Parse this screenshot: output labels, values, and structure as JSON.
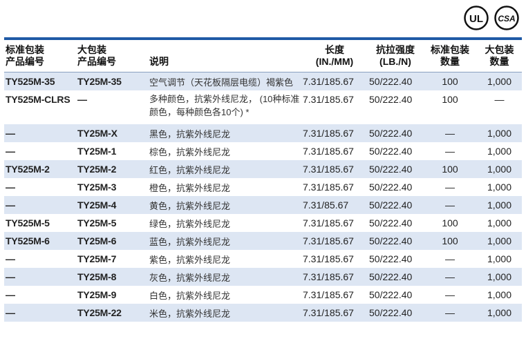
{
  "certifications": [
    "UL",
    "CSA"
  ],
  "brand_color": "#1f5aa6",
  "row_alt_color": "#dde6f3",
  "headers": {
    "std_part_line1": "标准包装",
    "std_part_line2": "产品编号",
    "bulk_part_line1": "大包装",
    "bulk_part_line2": "产品编号",
    "description": "说明",
    "length_line1": "长度",
    "length_line2": "(IN./MM)",
    "tensile_line1": "抗拉强度",
    "tensile_line2": "(LB./N)",
    "std_qty_line1": "标准包装",
    "std_qty_line2": "数量",
    "bulk_qty_line1": "大包装",
    "bulk_qty_line2": "数量"
  },
  "rows": [
    {
      "std_part": "TY525M-35",
      "bulk_part": "TY25M-35",
      "description": "空气调节（天花板隔层电缆）褐紫色",
      "length": "7.31/185.67",
      "tensile": "50/222.40",
      "std_qty": "100",
      "bulk_qty": "1,000"
    },
    {
      "std_part": "TY525M-CLRS",
      "bulk_part": "—",
      "description": "多种颜色，抗紫外线尼龙， (10种标准颜色，每种颜色各10个) *",
      "length": "7.31/185.67",
      "tensile": "50/222.40",
      "std_qty": "100",
      "bulk_qty": "—"
    },
    {
      "std_part": "—",
      "bulk_part": "TY25M-X",
      "description": "黑色，抗紫外线尼龙",
      "length": "7.31/185.67",
      "tensile": "50/222.40",
      "std_qty": "—",
      "bulk_qty": "1,000"
    },
    {
      "std_part": "—",
      "bulk_part": "TY25M-1",
      "description": "棕色，抗紫外线尼龙",
      "length": "7.31/185.67",
      "tensile": "50/222.40",
      "std_qty": "—",
      "bulk_qty": "1,000"
    },
    {
      "std_part": "TY525M-2",
      "bulk_part": "TY25M-2",
      "description": "红色，抗紫外线尼龙",
      "length": "7.31/185.67",
      "tensile": "50/222.40",
      "std_qty": "100",
      "bulk_qty": "1,000"
    },
    {
      "std_part": "—",
      "bulk_part": "TY25M-3",
      "description": "橙色，抗紫外线尼龙",
      "length": "7.31/185.67",
      "tensile": "50/222.40",
      "std_qty": "—",
      "bulk_qty": "1,000"
    },
    {
      "std_part": "—",
      "bulk_part": "TY25M-4",
      "description": "黄色，抗紫外线尼龙",
      "length": "7.31/85.67",
      "tensile": "50/222.40",
      "std_qty": "—",
      "bulk_qty": "1,000"
    },
    {
      "std_part": "TY525M-5",
      "bulk_part": "TY25M-5",
      "description": "绿色，抗紫外线尼龙",
      "length": "7.31/185.67",
      "tensile": "50/222.40",
      "std_qty": "100",
      "bulk_qty": "1,000"
    },
    {
      "std_part": "TY525M-6",
      "bulk_part": "TY25M-6",
      "description": "蓝色，抗紫外线尼龙",
      "length": "7.31/185.67",
      "tensile": "50/222.40",
      "std_qty": "100",
      "bulk_qty": "1,000"
    },
    {
      "std_part": "—",
      "bulk_part": "TY25M-7",
      "description": "紫色，抗紫外线尼龙",
      "length": "7.31/185.67",
      "tensile": "50/222.40",
      "std_qty": "—",
      "bulk_qty": "1,000"
    },
    {
      "std_part": "—",
      "bulk_part": "TY25M-8",
      "description": "灰色，抗紫外线尼龙",
      "length": "7.31/185.67",
      "tensile": "50/222.40",
      "std_qty": "—",
      "bulk_qty": "1,000"
    },
    {
      "std_part": "—",
      "bulk_part": "TY25M-9",
      "description": "白色，抗紫外线尼龙",
      "length": "7.31/185.67",
      "tensile": "50/222.40",
      "std_qty": "—",
      "bulk_qty": "1,000"
    },
    {
      "std_part": "—",
      "bulk_part": "TY25M-22",
      "description": "米色，抗紫外线尼龙",
      "length": "7.31/185.67",
      "tensile": "50/222.40",
      "std_qty": "—",
      "bulk_qty": "1,000"
    }
  ]
}
